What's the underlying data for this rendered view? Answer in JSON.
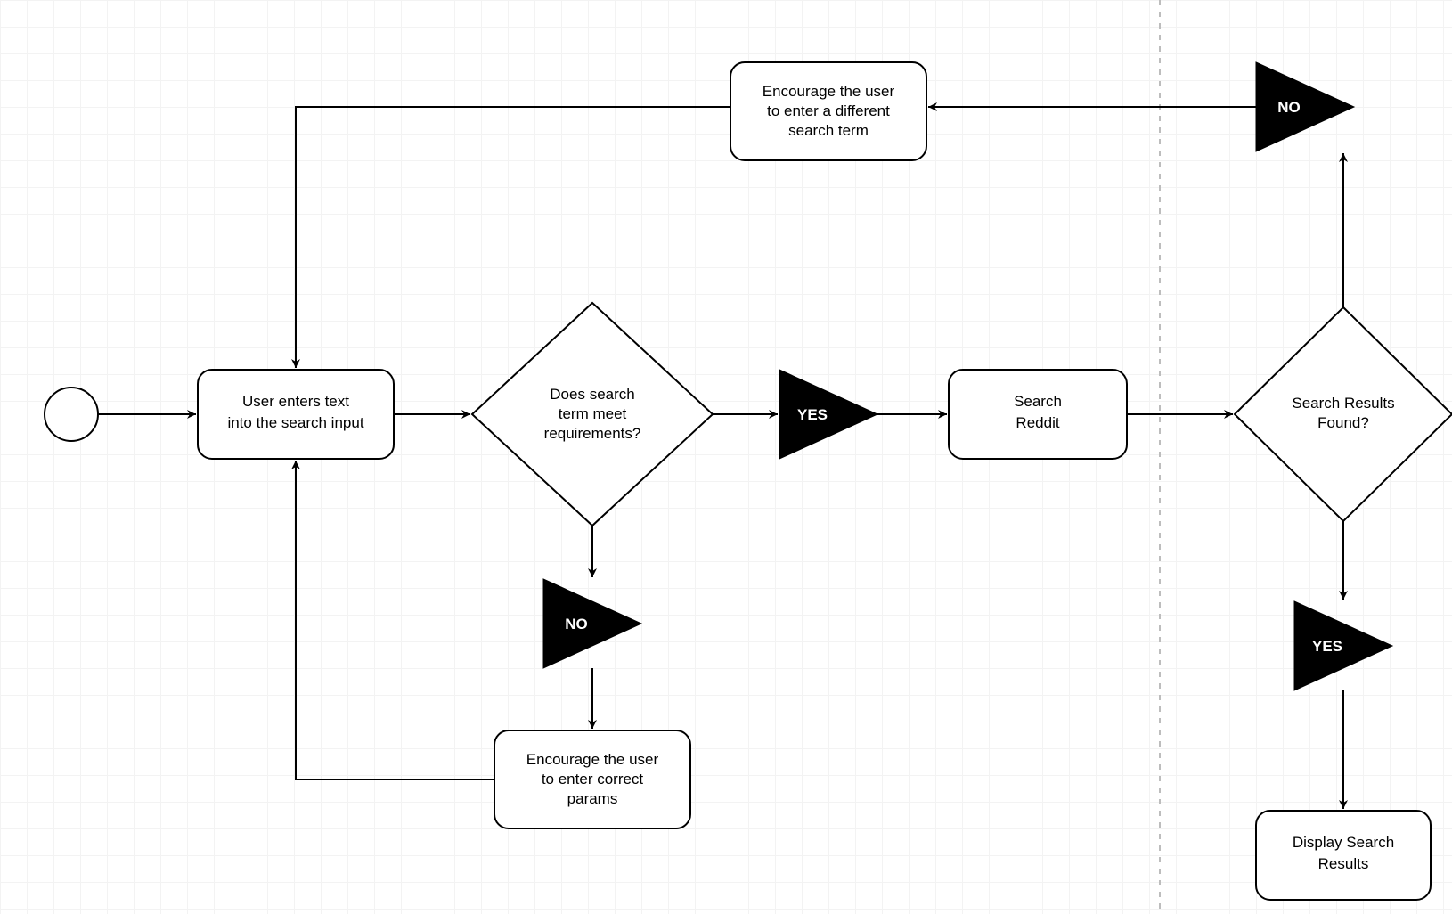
{
  "diagram": {
    "nodes": {
      "start": {
        "kind": "start",
        "label": ""
      },
      "user_enters": {
        "kind": "process",
        "line1": "User enters text",
        "line2": "into the search input"
      },
      "meets_req": {
        "kind": "decision",
        "line1": "Does search",
        "line2": "term meet",
        "line3": "requirements?"
      },
      "meets_req_yes": {
        "kind": "yes",
        "label": "YES"
      },
      "meets_req_no": {
        "kind": "no",
        "label": "NO"
      },
      "search_reddit": {
        "kind": "process",
        "line1": "Search",
        "line2": "Reddit"
      },
      "results_found": {
        "kind": "decision",
        "line1": "Search Results",
        "line2": "Found?"
      },
      "results_yes": {
        "kind": "yes",
        "label": "YES"
      },
      "results_no": {
        "kind": "no",
        "label": "NO"
      },
      "encourage_diff": {
        "kind": "process",
        "line1": "Encourage the user",
        "line2": "to enter a different",
        "line3": "search term"
      },
      "encourage_params": {
        "kind": "process",
        "line1": "Encourage the user",
        "line2": "to enter correct",
        "line3": "params"
      },
      "display_results": {
        "kind": "process",
        "line1": "Display Search",
        "line2": "Results"
      }
    }
  }
}
